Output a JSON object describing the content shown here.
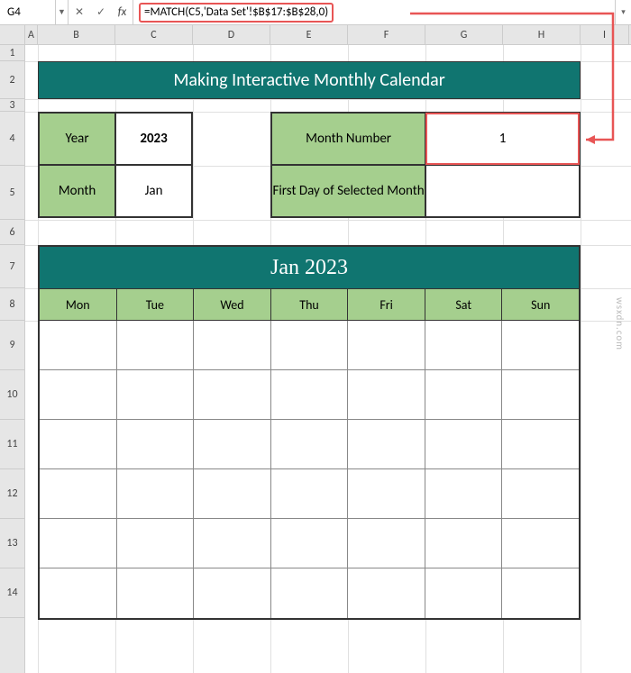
{
  "nameBox": "G4",
  "formula": "=MATCH(C5,'Data Set'!$B$17:$B$28,0)",
  "columns": [
    "A",
    "B",
    "C",
    "D",
    "E",
    "F",
    "G",
    "H",
    "I"
  ],
  "rows": [
    "1",
    "2",
    "3",
    "4",
    "5",
    "6",
    "7",
    "8",
    "9",
    "10",
    "11",
    "12",
    "13",
    "14"
  ],
  "banner": "Making Interactive Monthly Calendar",
  "table1": {
    "r1c1": "Year",
    "r1c2": "2023",
    "r2c1": "Month",
    "r2c2": "Jan"
  },
  "table2": {
    "r1c1": "Month Number",
    "r1c2": "1",
    "r2c1": "First Day of Selected Month",
    "r2c2": ""
  },
  "calendar": {
    "title": "Jan 2023",
    "days": [
      "Mon",
      "Tue",
      "Wed",
      "Thu",
      "Fri",
      "Sat",
      "Sun"
    ]
  },
  "watermark": "wsxdn.com"
}
